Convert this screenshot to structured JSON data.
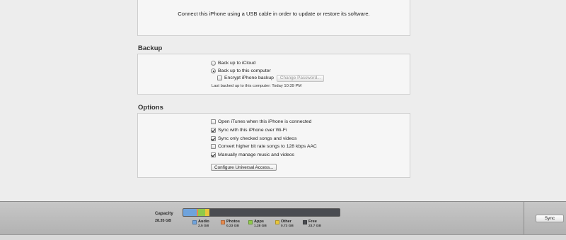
{
  "connect": {
    "message": "Connect this iPhone using a USB cable in order to update or restore its software."
  },
  "backup": {
    "title": "Backup",
    "options": [
      {
        "label": "Back up to iCloud",
        "selected": false
      },
      {
        "label": "Back up to this computer",
        "selected": true
      }
    ],
    "encrypt": {
      "label": "Encrypt iPhone backup",
      "checked": false
    },
    "change_password_label": "Change Password...",
    "last_backup": "Last backed up to this computer: Today 10:39 PM"
  },
  "options": {
    "title": "Options",
    "items": [
      {
        "label": "Open iTunes when this iPhone is connected",
        "checked": false
      },
      {
        "label": "Sync with this iPhone over Wi-Fi",
        "checked": true
      },
      {
        "label": "Sync only checked songs and videos",
        "checked": true
      },
      {
        "label": "Convert higher bit rate songs to 128 kbps AAC",
        "checked": false
      },
      {
        "label": "Manually manage music and videos",
        "checked": true
      }
    ],
    "configure_label": "Configure Universal Access..."
  },
  "capacity": {
    "label": "Capacity",
    "total": "28.35 GB",
    "segments": [
      {
        "name": "Audio",
        "size": "2.5 GB",
        "fraction": 0.088,
        "color": "#6fa3dc"
      },
      {
        "name": "Photos",
        "size": "0.23 GB",
        "fraction": 0.008,
        "color": "#e58a4f"
      },
      {
        "name": "Apps",
        "size": "1.28 GB",
        "fraction": 0.045,
        "color": "#8fc94a"
      },
      {
        "name": "Other",
        "size": "0.73 GB",
        "fraction": 0.026,
        "color": "#e8c53a"
      },
      {
        "name": "Free",
        "size": "23.7 GB",
        "fraction": 0.833,
        "color": "#4a4c51"
      }
    ]
  },
  "sync_label": "Sync"
}
